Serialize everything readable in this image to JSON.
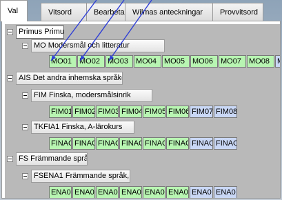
{
  "tabs": [
    "Val",
    "Vitsord",
    "Bearbeta",
    "Wilmas anteckningar",
    "Provvitsord"
  ],
  "tree": {
    "root_label": "Primus Primus",
    "groups": [
      {
        "label": "MO Modersmål och litteratur",
        "subgroups": [
          {
            "label": "",
            "cells": [
              "MO01",
              "MO02",
              "MO03",
              "MO04",
              "MO05",
              "MO06",
              "MO07",
              "MO08",
              "MC"
            ],
            "colors": [
              "green",
              "green",
              "green",
              "green",
              "green",
              "green",
              "green",
              "green",
              "blue"
            ]
          }
        ]
      },
      {
        "label": "AIS Det andra inhemska språket",
        "subgroups": [
          {
            "label": "FIM Finska, modersmålsinrik",
            "cells": [
              "FIM01",
              "FIM02",
              "FIM03",
              "FIM04",
              "FIM05",
              "FIM06",
              "FIM07",
              "FIM08"
            ],
            "colors": [
              "green",
              "green",
              "green",
              "green",
              "green",
              "green",
              "blue",
              "blue"
            ]
          },
          {
            "label": "TKFIA1 Finska, A-lärokurs",
            "cells": [
              "FINAC",
              "FINAC",
              "FINAC",
              "FINAC",
              "FINAC",
              "FINAC",
              "FINAC",
              "FINAC"
            ],
            "colors": [
              "green",
              "green",
              "green",
              "green",
              "green",
              "green",
              "blue",
              "blue"
            ]
          }
        ]
      },
      {
        "label": "FS Främmande språk",
        "subgroups": [
          {
            "label": "FSENA1 Främmande språk,",
            "cells": [
              "ENA0",
              "ENA0",
              "ENA0",
              "ENA0",
              "ENA0",
              "ENA0",
              "ENA0",
              "ENA0"
            ],
            "colors": [
              "green",
              "green",
              "green",
              "green",
              "green",
              "green",
              "blue",
              "blue"
            ]
          }
        ]
      }
    ]
  },
  "colors": {
    "completed": "#b8f5b2",
    "pending": "#c9d7f5",
    "arrow": "#2f3fd6"
  }
}
